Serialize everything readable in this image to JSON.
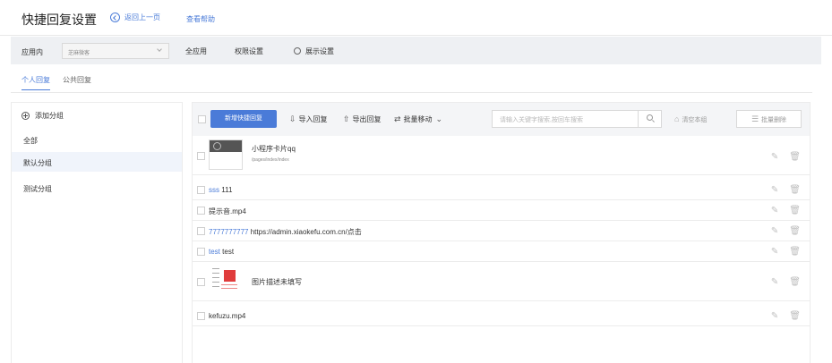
{
  "header": {
    "title": "快捷回复设置",
    "back_label": "返回上一页",
    "help_label": "查看帮助"
  },
  "toolbar": {
    "app_label": "应用内",
    "app_select_value": "芝麻微客",
    "items": [
      "全应用",
      "权限设置",
      "展示设置"
    ]
  },
  "tabs": [
    "个人回复",
    "公共回复"
  ],
  "sidebar": {
    "add_group": "添加分组",
    "groups": [
      "全部",
      "默认分组",
      "测试分组"
    ],
    "active_group": "默认分组"
  },
  "actions": {
    "new_button": "新增快捷回复",
    "import": "导入回复",
    "export": "导出回复",
    "batch_move": "批量移动",
    "search_placeholder": "请输入关键字搜索,按回车搜索",
    "clear_group": "清空本组",
    "batch_delete": "批量删除"
  },
  "replies": [
    {
      "type": "miniprogram",
      "title": "小程序卡片qq",
      "path": "/pages/index/index"
    },
    {
      "type": "text",
      "keyword": "sss",
      "content": "111"
    },
    {
      "type": "file",
      "content": "提示音.mp4"
    },
    {
      "type": "text",
      "keyword": "7777777777",
      "content": "https://admin.xiaokefu.com.cn/点击"
    },
    {
      "type": "text",
      "keyword": "test",
      "content": "test"
    },
    {
      "type": "image",
      "content": "图片描述未填写"
    },
    {
      "type": "file",
      "content": "kefuzu.mp4"
    }
  ],
  "colors": {
    "accent": "#4a7bd8",
    "toolbar_bg": "#eef0f3",
    "active_group_bg": "#f0f4fb"
  },
  "icons": {
    "back": "circle-chevron-left-icon",
    "settings": "gear-icon",
    "add": "circle-plus-icon",
    "import": "upload-icon",
    "export": "export-icon",
    "batch_move": "swap-arrows-icon",
    "search": "search-icon",
    "clear": "basket-icon",
    "batch_delete": "list-delete-icon",
    "edit": "pencil-icon",
    "delete": "trash-icon"
  }
}
